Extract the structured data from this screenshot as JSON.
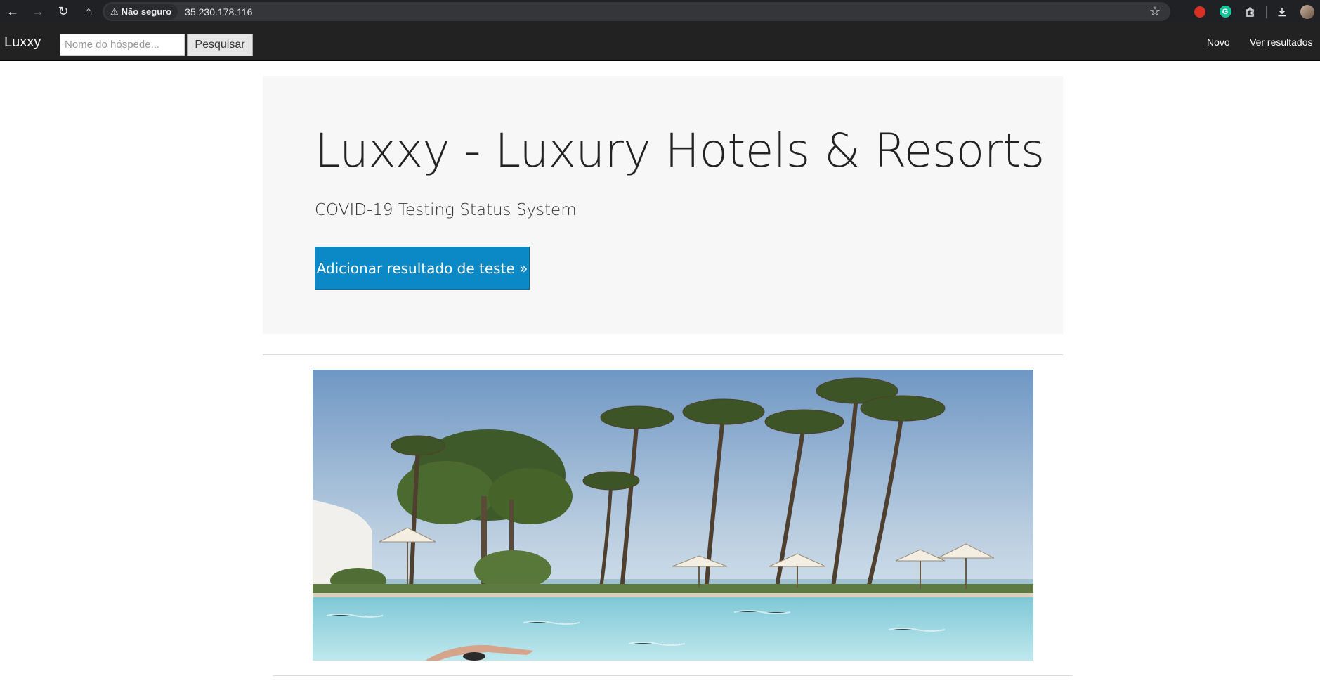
{
  "browser": {
    "security_label": "Não seguro",
    "url": "35.230.178.116"
  },
  "navbar": {
    "brand": "Luxxy",
    "search_placeholder": "Nome do hóspede...",
    "search_button": "Pesquisar",
    "links": [
      "Novo",
      "Ver resultados"
    ]
  },
  "jumbotron": {
    "title": "Luxxy - Luxury Hotels & Resorts",
    "subtitle": "COVID-19 Testing Status System",
    "button": "Adicionar resultado de teste »"
  },
  "colors": {
    "navbar_bg": "#222222",
    "jumbotron_bg": "#f7f7f7",
    "button_bg": "#0a89c6"
  }
}
